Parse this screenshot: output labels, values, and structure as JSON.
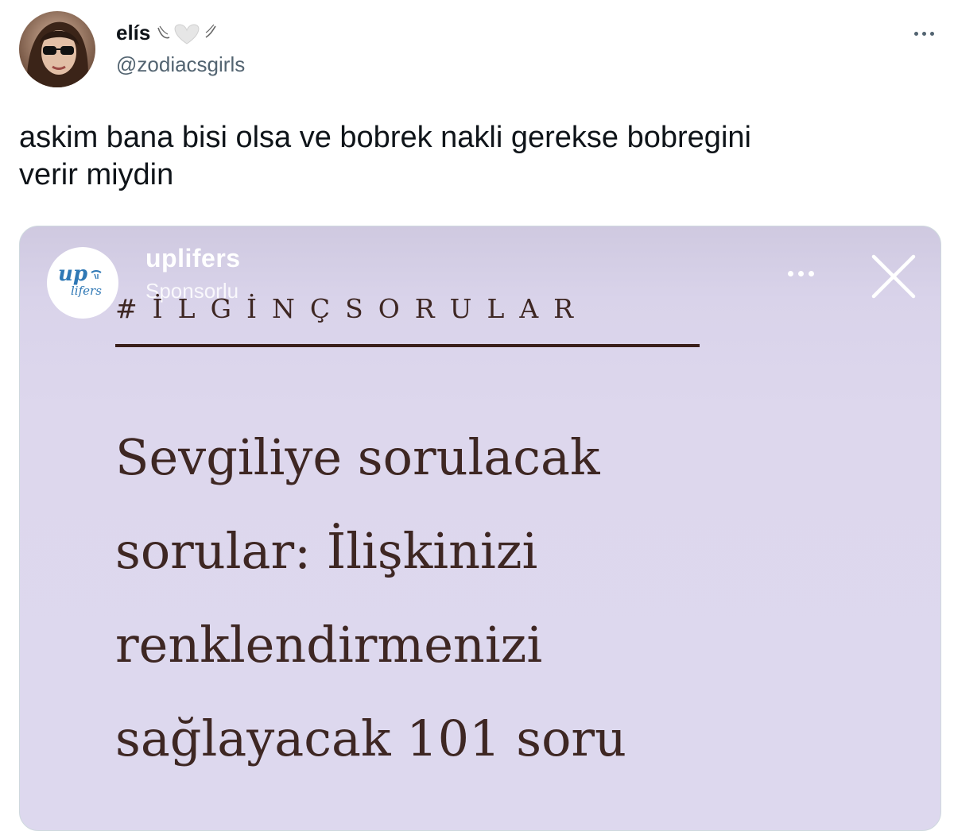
{
  "tweet": {
    "display_name": "elís",
    "handle": "@zodiacsgirls",
    "text_line1": "askim bana bisi olsa ve bobrek nakli gerekse bobregini",
    "text_line2": "verir miydin"
  },
  "story": {
    "account_name": "uplifers",
    "sponsored_label": "Sponsorlu",
    "logo_text_top": "up",
    "logo_text_bottom": "lifers",
    "hashtag": "#İLGİNÇSORULAR",
    "headline_lines": [
      "Sevgiliye sorulacak",
      "sorular: İlişkinizi",
      "renklendirmenizi",
      "sağlayacak 101 soru"
    ]
  },
  "colors": {
    "story_background": "#ddd8ee",
    "headline_text": "#3e2723",
    "handle_gray": "#536471"
  },
  "icons": [
    "avatar-photo",
    "angel-heart-emoji",
    "more-icon",
    "close-icon",
    "uplifers-logo"
  ]
}
